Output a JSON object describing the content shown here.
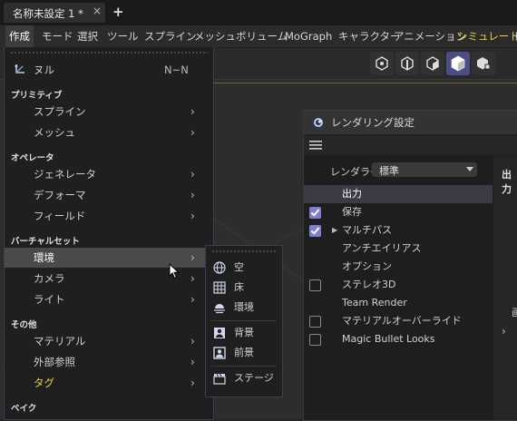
{
  "tab": {
    "title": "名称未設定 1 *",
    "close": "×",
    "new": "+"
  },
  "menubar": [
    "作成",
    "モード",
    "選択",
    "ツール",
    "スプライン",
    "メッシュ",
    "ボリューム",
    "MoGraph",
    "キャラクター",
    "アニメーション",
    "シミュレート",
    "ト"
  ],
  "create_menu": {
    "null": {
      "label": "ヌル",
      "shortcut": "N~N"
    },
    "sections": {
      "primitive": "プリミティブ",
      "operator": "オペレータ",
      "virtual": "バーチャルセット",
      "other": "その他",
      "bake": "ベイク"
    },
    "items": {
      "spline": "スプライン",
      "mesh": "メッシュ",
      "generator": "ジェネレータ",
      "deformer": "デフォーマ",
      "field": "フィールド",
      "environment": "環境",
      "camera": "カメラ",
      "light": "ライト",
      "material": "マテリアル",
      "xref": "外部参照",
      "tag": "タグ"
    },
    "arrow": "›"
  },
  "submenu": {
    "sky": "空",
    "floor": "床",
    "environment": "環境",
    "background": "背景",
    "foreground": "前景",
    "stage": "ステージ"
  },
  "render_window": {
    "title": "レンダリング設定",
    "renderer_label": "レンダラー",
    "renderer_value": "標準",
    "output_header": "出力",
    "items": [
      {
        "label": "出力",
        "checkbox": false,
        "checked": false,
        "selected": true
      },
      {
        "label": "保存",
        "checkbox": true,
        "checked": true
      },
      {
        "label": "マルチパス",
        "checkbox": true,
        "checked": true,
        "expand": true
      },
      {
        "label": "アンチエイリアス",
        "checkbox": false
      },
      {
        "label": "オプション",
        "checkbox": false
      },
      {
        "label": "ステレオ3D",
        "checkbox": true,
        "checked": false
      },
      {
        "label": "Team Render",
        "checkbox": false
      },
      {
        "label": "マテリアルオーバーライド",
        "checkbox": true,
        "checked": false
      },
      {
        "label": "Magic Bullet Looks",
        "checkbox": true,
        "checked": false
      }
    ],
    "right_fragment": "画"
  },
  "colors": {
    "accent": "#4c4d86",
    "tag_yellow": "#e8d34a",
    "highlight": "#4a4a4a"
  }
}
